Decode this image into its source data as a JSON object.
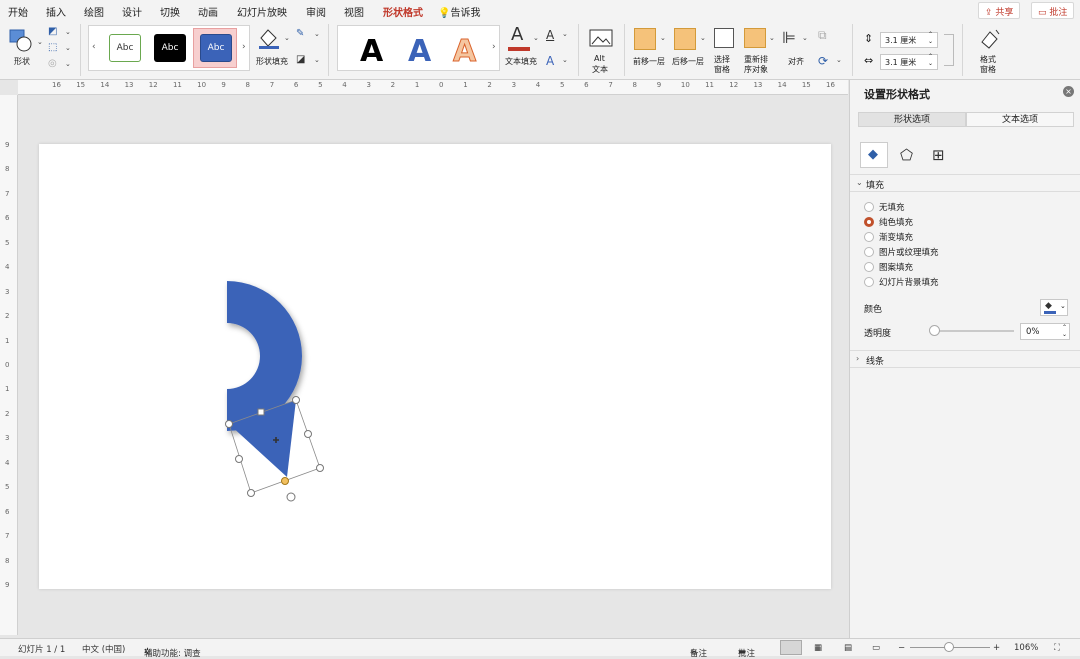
{
  "menu": {
    "tabs": [
      "开始",
      "插入",
      "绘图",
      "设计",
      "切换",
      "动画",
      "幻灯片放映",
      "审阅",
      "视图",
      "形状格式",
      "告诉我"
    ],
    "active_tab": "形状格式",
    "share_button": "共享",
    "comment_button": "批注"
  },
  "ribbon": {
    "shape_label": "形状",
    "style_samples": [
      "Abc",
      "Abc",
      "Abc"
    ],
    "shape_fill_label": "形状填充",
    "wordart_samples": [
      "A",
      "A",
      "A"
    ],
    "text_fill_label": "文本填充",
    "alt_text_label_1": "Alt",
    "alt_text_label_2": "文本",
    "bring_forward_label": "前移一层",
    "send_backward_label": "后移一层",
    "selection_pane_label_1": "选择",
    "selection_pane_label_2": "窗格",
    "reorder_label_1": "重新排",
    "reorder_label_2": "序对象",
    "align_label": "对齐",
    "height_value": "3.1 厘米",
    "width_value": "3.1 厘米",
    "format_pane_label_1": "格式",
    "format_pane_label_2": "窗格",
    "colors": {
      "accent": "#c0392b",
      "shape_blue": "#3b63b8",
      "text_fill_bar": "#c0392b"
    }
  },
  "ruler": {
    "h_numbers": [
      "16",
      "15",
      "14",
      "13",
      "12",
      "11",
      "10",
      "9",
      "8",
      "7",
      "6",
      "5",
      "4",
      "3",
      "2",
      "1",
      "0",
      "1",
      "2",
      "3",
      "4",
      "5",
      "6",
      "7",
      "8",
      "9",
      "10",
      "11",
      "12",
      "13",
      "14",
      "15",
      "16"
    ],
    "v_numbers": [
      "9",
      "8",
      "7",
      "6",
      "5",
      "4",
      "3",
      "2",
      "1",
      "0",
      "1",
      "2",
      "3",
      "4",
      "5",
      "6",
      "7",
      "8",
      "9"
    ]
  },
  "pane": {
    "title": "设置形状格式",
    "tab_shape": "形状选项",
    "tab_text": "文本选项",
    "fill_section": "填充",
    "fill_options": [
      "无填充",
      "纯色填充",
      "渐变填充",
      "图片或纹理填充",
      "图案填充",
      "幻灯片背景填充"
    ],
    "selected_fill": "纯色填充",
    "color_label": "颜色",
    "transparency_label": "透明度",
    "transparency_value": "0%",
    "line_section": "线条"
  },
  "status": {
    "slide_info": "幻灯片 1 / 1",
    "language": "中文 (中国)",
    "accessibility": "辅助功能: 调查",
    "notes": "备注",
    "comments": "批注",
    "zoom": "106%"
  }
}
